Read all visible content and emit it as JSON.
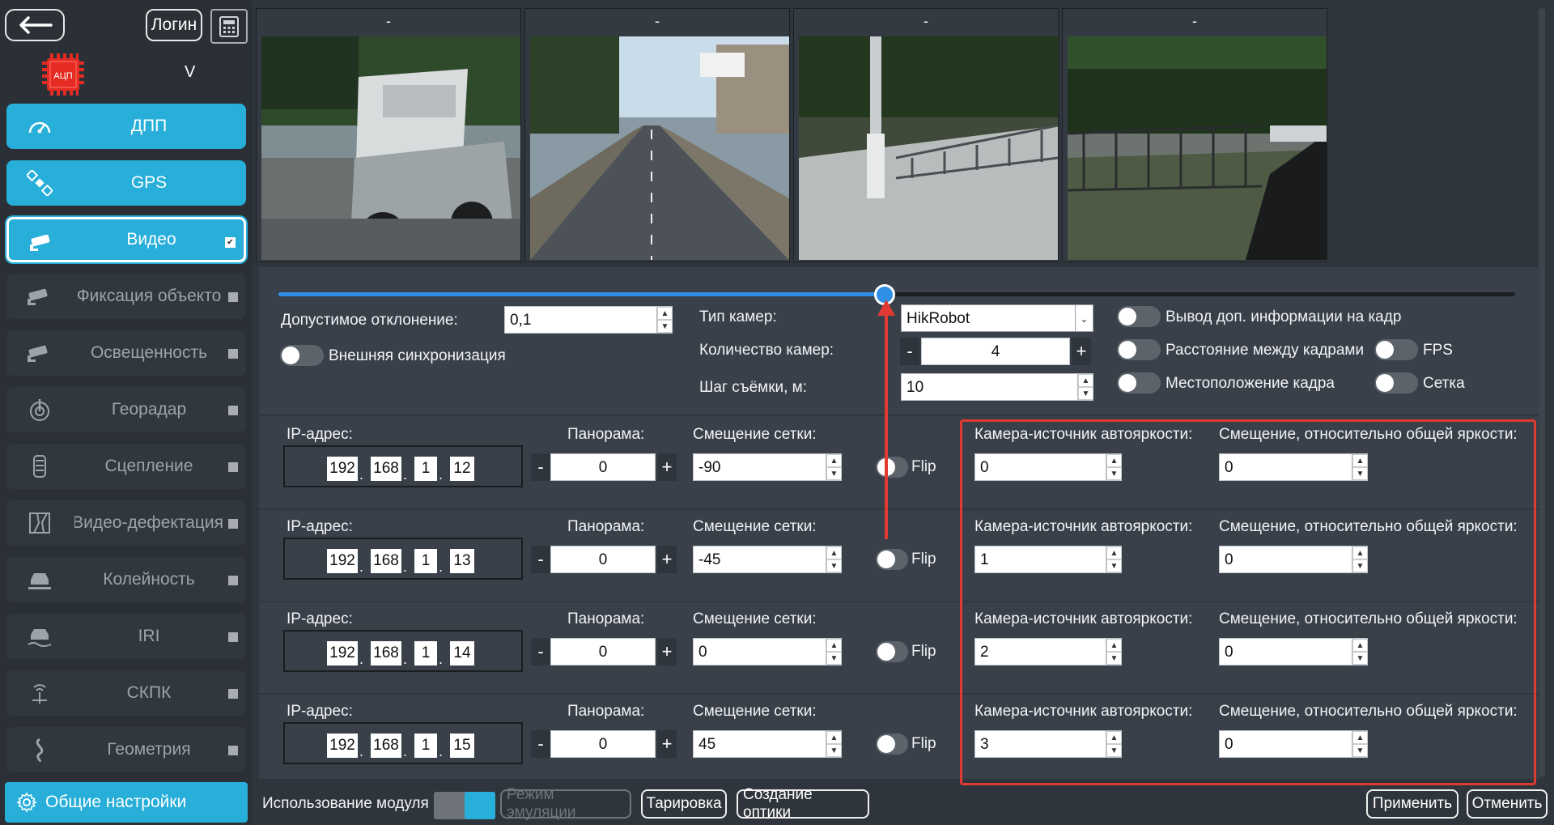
{
  "header": {
    "login_label": "Логин",
    "version": "V",
    "logo_text": "АЦП"
  },
  "sidebar": {
    "items": [
      {
        "label": "ДПП",
        "icon": "speedometer-icon",
        "state": "active"
      },
      {
        "label": "GPS",
        "icon": "satellite-icon",
        "state": "active"
      },
      {
        "label": "Видео",
        "icon": "camera-icon",
        "state": "selected"
      },
      {
        "label": "Фиксация объекто",
        "icon": "camera-icon",
        "state": "inactive"
      },
      {
        "label": "Освещенность",
        "icon": "camera-icon",
        "state": "inactive"
      },
      {
        "label": "Георадар",
        "icon": "radar-icon",
        "state": "inactive"
      },
      {
        "label": "Сцепление",
        "icon": "tire-icon",
        "state": "inactive"
      },
      {
        "label": "Видео-дефектация",
        "icon": "road-map-icon",
        "state": "inactive"
      },
      {
        "label": "Колейность",
        "icon": "car-road-icon",
        "state": "inactive"
      },
      {
        "label": "IRI",
        "icon": "car-bump-icon",
        "state": "inactive"
      },
      {
        "label": "СКПК",
        "icon": "signal-tower-icon",
        "state": "inactive"
      },
      {
        "label": "Геометрия",
        "icon": "winding-road-icon",
        "state": "inactive"
      }
    ],
    "settings_label": "Общие настройки"
  },
  "cameras": [
    {
      "title": "-"
    },
    {
      "title": "-"
    },
    {
      "title": "-"
    },
    {
      "title": "-"
    }
  ],
  "slider": {
    "value_fraction": 0.49
  },
  "settings": {
    "deviation_label": "Допустимое отклонение:",
    "deviation_value": "0,1",
    "sync_label": "Внешняя синхронизация",
    "camera_type_label": "Тип камер:",
    "camera_type_value": "HikRobot",
    "camera_count_label": "Количество камер:",
    "camera_count_value": "4",
    "step_label": "Шаг съёмки, м:",
    "step_value": "10",
    "info_label": "Вывод доп. информации на кадр",
    "distance_label": "Расстояние между кадрами",
    "fps_label": "FPS",
    "position_label": "Местоположение кадра",
    "grid_label": "Сетка"
  },
  "camera_rows_labels": {
    "ip": "IP-адрес:",
    "panorama": "Панорама:",
    "grid_offset": "Смещение сетки:",
    "flip": "Flip",
    "auto_src": "Камера-источник автояркости:",
    "bright_offset": "Смещение, относительно общей яркости:"
  },
  "camera_rows": [
    {
      "ip": [
        "192",
        "168",
        "1",
        "12"
      ],
      "panorama": "0",
      "grid_offset": "-90",
      "auto_src": "0",
      "bright_offset": "0"
    },
    {
      "ip": [
        "192",
        "168",
        "1",
        "13"
      ],
      "panorama": "0",
      "grid_offset": "-45",
      "auto_src": "1",
      "bright_offset": "0"
    },
    {
      "ip": [
        "192",
        "168",
        "1",
        "14"
      ],
      "panorama": "0",
      "grid_offset": "0",
      "auto_src": "2",
      "bright_offset": "0"
    },
    {
      "ip": [
        "192",
        "168",
        "1",
        "15"
      ],
      "panorama": "0",
      "grid_offset": "45",
      "auto_src": "3",
      "bright_offset": "0"
    }
  ],
  "footer": {
    "module_label": "Использование модуля",
    "emulation_label": "Режим эмуляции",
    "tare_label": "Тарировка",
    "optics_label": "Создание оптики",
    "apply_label": "Применить",
    "cancel_label": "Отменить"
  },
  "colors": {
    "accent": "#27aed9",
    "annotation": "#e03a33"
  }
}
